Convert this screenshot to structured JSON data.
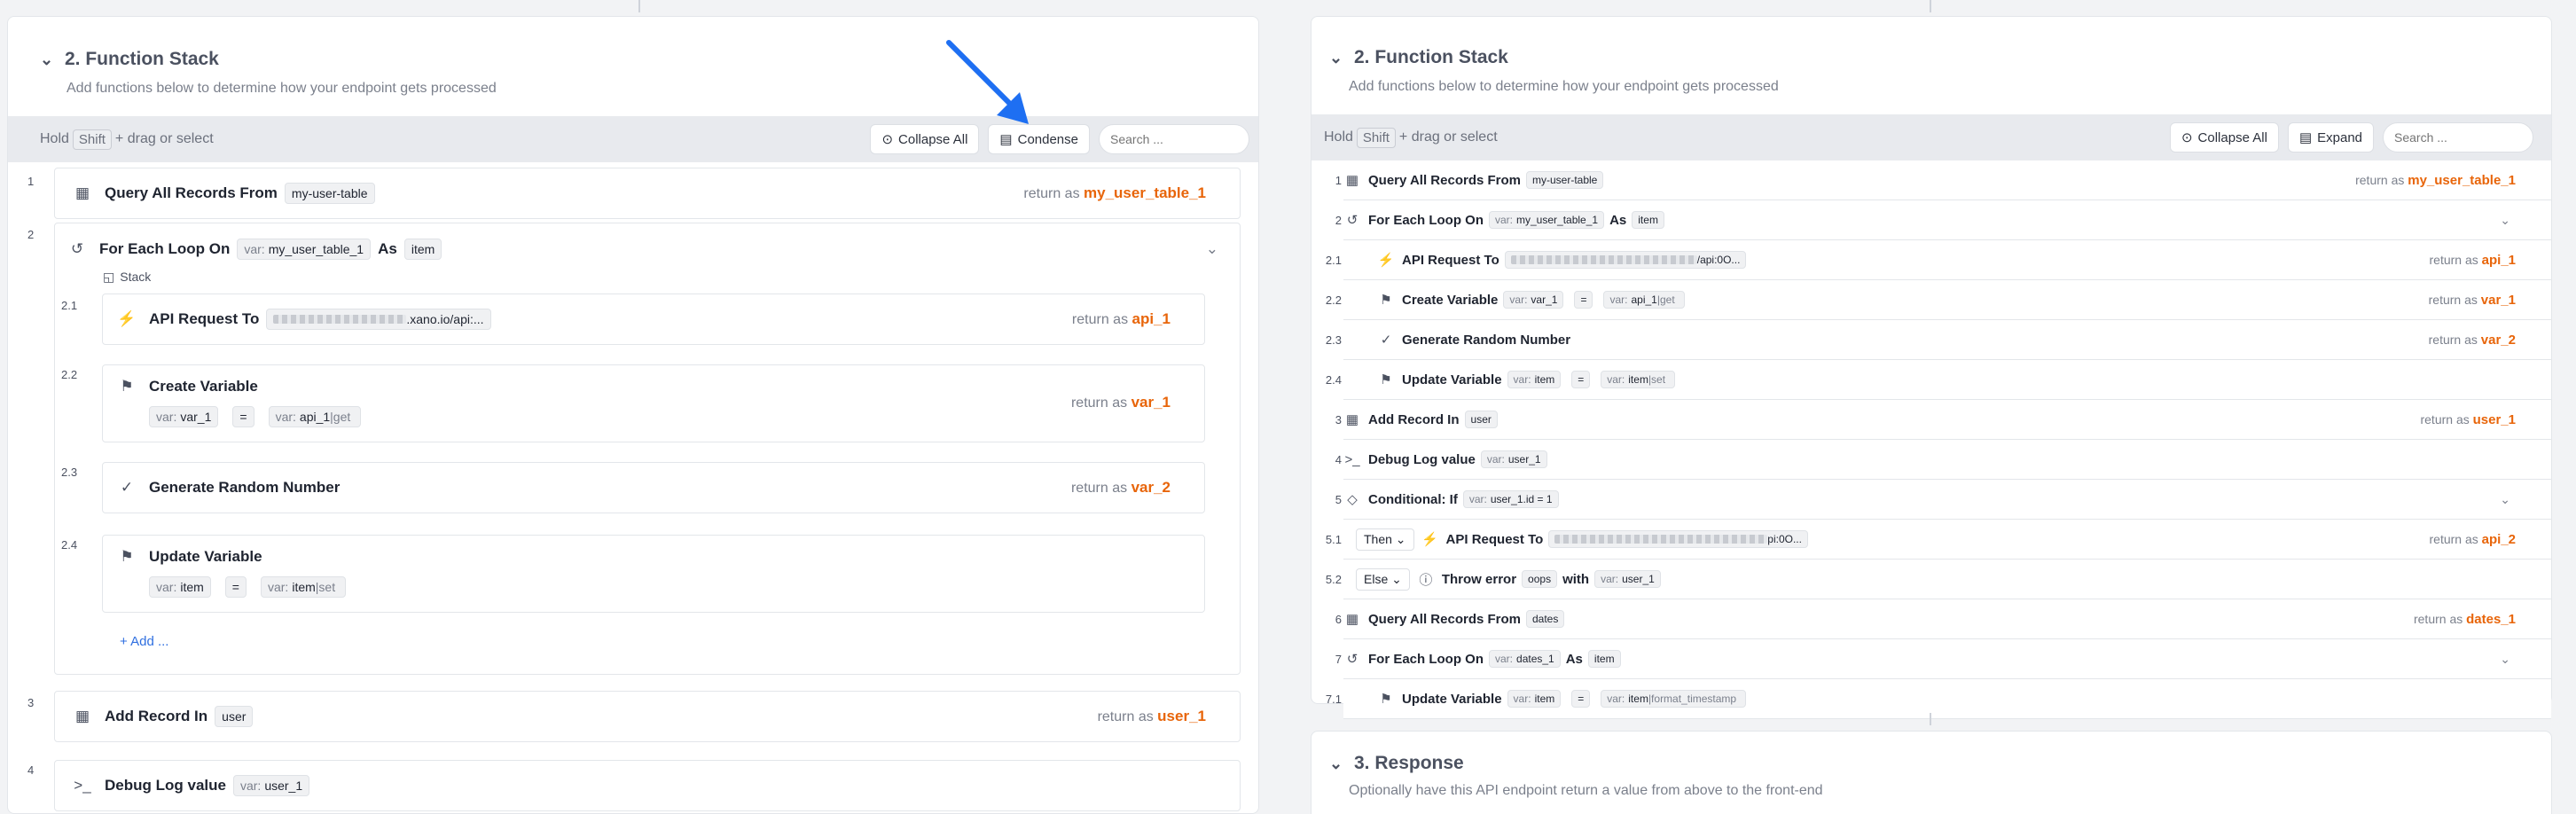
{
  "left": {
    "section_title": "2. Function Stack",
    "section_subtitle": "Add functions below to determine how your endpoint gets processed",
    "toolbar": {
      "hold_prefix": "Hold",
      "hold_key": "Shift",
      "hold_suffix": "+ drag or select",
      "collapse_all": "Collapse All",
      "condense": "Condense",
      "search_placeholder": "Search ..."
    },
    "rows": {
      "r1": {
        "num": "1",
        "title": "Query All Records From",
        "chip": "my-user-table",
        "ret_label": "return as",
        "ret_var": "my_user_table_1"
      },
      "r2": {
        "num": "2",
        "title": "For Each Loop On",
        "chip_prefix": "var:",
        "chip": "my_user_table_1",
        "as": "As",
        "as_chip": "item",
        "stack_label": "Stack"
      },
      "r21": {
        "num": "2.1",
        "title": "API Request To",
        "url_tail": ".xano.io/api:...",
        "ret_label": "return as",
        "ret_var": "api_1"
      },
      "r22": {
        "num": "2.2",
        "title": "Create Variable",
        "c1_prefix": "var:",
        "c1": "var_1",
        "eq": "=",
        "c2_prefix": "var:",
        "c2": "api_1",
        "c2_filter": "|get",
        "ret_label": "return as",
        "ret_var": "var_1"
      },
      "r23": {
        "num": "2.3",
        "title": "Generate Random Number",
        "ret_label": "return as",
        "ret_var": "var_2"
      },
      "r24": {
        "num": "2.4",
        "title": "Update Variable",
        "c1_prefix": "var:",
        "c1": "item",
        "eq": "=",
        "c2_prefix": "var:",
        "c2": "item",
        "c2_filter": "|set"
      },
      "add": "+ Add ...",
      "r3": {
        "num": "3",
        "title": "Add Record In",
        "chip": "user",
        "ret_label": "return as",
        "ret_var": "user_1"
      },
      "r4": {
        "num": "4",
        "title": "Debug Log value",
        "chip_prefix": "var:",
        "chip": "user_1"
      }
    }
  },
  "right": {
    "section_title": "2. Function Stack",
    "section_subtitle": "Add functions below to determine how your endpoint gets processed",
    "toolbar": {
      "hold_prefix": "Hold",
      "hold_key": "Shift",
      "hold_suffix": "+ drag or select",
      "collapse_all": "Collapse All",
      "expand": "Expand",
      "search_placeholder": "Search ..."
    },
    "rows": {
      "r1": {
        "num": "1",
        "title": "Query All Records From",
        "chip": "my-user-table",
        "ret_label": "return as",
        "ret_var": "my_user_table_1"
      },
      "r2": {
        "num": "2",
        "title": "For Each Loop On",
        "chip_prefix": "var:",
        "chip": "my_user_table_1",
        "as": "As",
        "as_chip": "item"
      },
      "r21": {
        "num": "2.1",
        "title": "API Request To",
        "url_tail": "/api:0O...",
        "ret_label": "return as",
        "ret_var": "api_1"
      },
      "r22": {
        "num": "2.2",
        "title": "Create Variable",
        "c1_prefix": "var:",
        "c1": "var_1",
        "eq": "=",
        "c2_prefix": "var:",
        "c2": "api_1",
        "c2_filter": "|get",
        "ret_label": "return as",
        "ret_var": "var_1"
      },
      "r23": {
        "num": "2.3",
        "title": "Generate Random Number",
        "ret_label": "return as",
        "ret_var": "var_2"
      },
      "r24": {
        "num": "2.4",
        "title": "Update Variable",
        "c1_prefix": "var:",
        "c1": "item",
        "eq": "=",
        "c2_prefix": "var:",
        "c2": "item",
        "c2_filter": "|set"
      },
      "r3": {
        "num": "3",
        "title": "Add Record In",
        "chip": "user",
        "ret_label": "return as",
        "ret_var": "user_1"
      },
      "r4": {
        "num": "4",
        "title": "Debug Log value",
        "chip_prefix": "var:",
        "chip": "user_1"
      },
      "r5": {
        "num": "5",
        "title": "Conditional: If",
        "chip_prefix": "var:",
        "chip": "user_1.id = 1"
      },
      "r51": {
        "num": "5.1",
        "branch": "Then",
        "title": "API Request To",
        "url_tail": "pi:0O...",
        "ret_label": "return as",
        "ret_var": "api_2"
      },
      "r52": {
        "num": "5.2",
        "branch": "Else",
        "title": "Throw error",
        "chip": "oops",
        "with": "with",
        "chip2_prefix": "var:",
        "chip2": "user_1"
      },
      "r6": {
        "num": "6",
        "title": "Query All Records From",
        "chip": "dates",
        "ret_label": "return as",
        "ret_var": "dates_1"
      },
      "r7": {
        "num": "7",
        "title": "For Each Loop On",
        "chip_prefix": "var:",
        "chip": "dates_1",
        "as": "As",
        "as_chip": "item"
      },
      "r71": {
        "num": "7.1",
        "title": "Update Variable",
        "c1_prefix": "var:",
        "c1": "item",
        "eq": "=",
        "c2_prefix": "var:",
        "c2": "item",
        "c2_filter": "|format_timestamp"
      }
    },
    "response": {
      "title": "3. Response",
      "subtitle": "Optionally have this API endpoint return a value from above to the front-end"
    }
  },
  "colors": {
    "accent_orange": "#e8650a",
    "arrow_blue": "#1e6ff2"
  }
}
